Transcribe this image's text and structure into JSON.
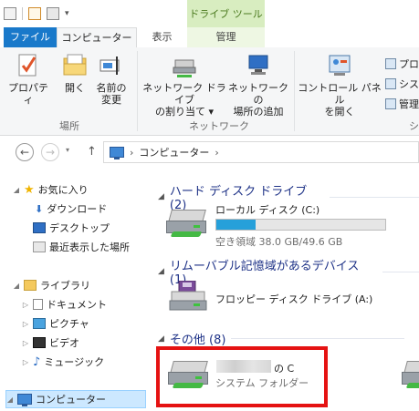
{
  "ribbon": {
    "contextual_label": "ドライブ ツール",
    "tabs": {
      "file": "ファイル",
      "computer": "コンピューター",
      "view": "表示",
      "manage": "管理"
    },
    "groups": {
      "location": {
        "label": "場所",
        "buttons": {
          "properties": "プロパティ",
          "open": "開く",
          "rename": [
            "名前の",
            "変更"
          ]
        }
      },
      "network": {
        "label": "ネットワーク",
        "buttons": {
          "map_drive": [
            "ネットワーク ドライブ",
            "の割り当て ▾"
          ],
          "add_location": [
            "ネットワークの",
            "場所の追加"
          ]
        }
      },
      "system": {
        "label": "シ",
        "buttons": {
          "control_panel": [
            "コントロール パネル",
            "を開く"
          ]
        },
        "small_items": [
          "プロ",
          "シス",
          "管理"
        ]
      }
    }
  },
  "address": {
    "back_icon": "back-arrow-icon",
    "forward_icon": "forward-arrow-icon",
    "crumb_sep": "›",
    "crumb": "コンピューター",
    "crumb_end": "›"
  },
  "nav": {
    "favorites": {
      "label": "お気に入り",
      "items": [
        "ダウンロード",
        "デスクトップ",
        "最近表示した場所"
      ]
    },
    "libraries": {
      "label": "ライブラリ",
      "items": [
        "ドキュメント",
        "ピクチャ",
        "ビデオ",
        "ミュージック"
      ]
    },
    "computer": "コンピューター"
  },
  "content": {
    "sections": {
      "hdd": "ハード ディスク ドライブ (2)",
      "removable": "リムーバブル記憶域があるデバイス (1)",
      "other": "その他 (8)"
    },
    "local_disk": {
      "name": "ローカル ディスク (C:)",
      "space": "空き領域 38.0 GB/49.6 GB",
      "used_fraction": 0.234
    },
    "floppy": {
      "name": "フロッピー ディスク ドライブ (A:)"
    },
    "other_item": {
      "name_suffix": "の C",
      "type": "システム フォルダー"
    }
  },
  "colors": {
    "accent": "#1979ca",
    "section_text": "#1e3287",
    "highlight": "#e51212",
    "bar_fill": "#26a0da"
  }
}
